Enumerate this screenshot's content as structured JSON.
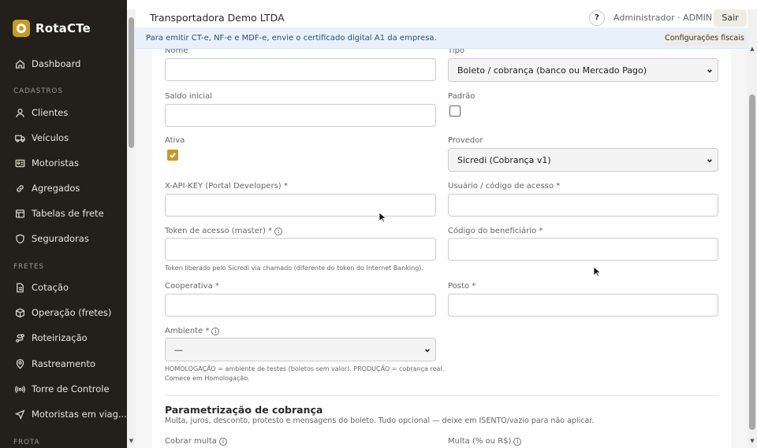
{
  "brand": {
    "name": "RotaCTe"
  },
  "sidebar": {
    "items": [
      {
        "label": "Dashboard",
        "icon": "home-icon"
      },
      {
        "label": "Clientes",
        "icon": "user-icon"
      },
      {
        "label": "Veículos",
        "icon": "truck-icon"
      },
      {
        "label": "Motoristas",
        "icon": "id-card-icon"
      },
      {
        "label": "Agregados",
        "icon": "link-icon"
      },
      {
        "label": "Tabelas de frete",
        "icon": "table-icon"
      },
      {
        "label": "Seguradoras",
        "icon": "shield-icon"
      },
      {
        "label": "Cotação",
        "icon": "document-icon"
      },
      {
        "label": "Operação (fretes)",
        "icon": "box-icon"
      },
      {
        "label": "Roteirização",
        "icon": "route-icon"
      },
      {
        "label": "Rastreamento",
        "icon": "location-pin-icon"
      },
      {
        "label": "Torre de Controle",
        "icon": "broadcast-icon"
      },
      {
        "label": "Motoristas em viag...",
        "icon": "navigation-icon"
      }
    ],
    "sections": {
      "cadastros": "CADASTROS",
      "fretes": "FRETES",
      "frota": "FROTA"
    }
  },
  "header": {
    "company": "Transportadora Demo LTDA",
    "help": "?",
    "user": "Administrador · ADMIN",
    "logout": "Sair"
  },
  "banner": {
    "text": "Para emitir CT-e, NF-e e MDF-e, envie o certificado digital A1 da empresa.",
    "button": "Configurações fiscais"
  },
  "form": {
    "nome_label": "Nome",
    "tipo_label": "Tipo",
    "tipo_value": "Boleto / cobrança (banco ou Mercado Pago)",
    "saldo_label": "Saldo inicial",
    "padrao_label": "Padrão",
    "ativa_label": "Ativa",
    "provedor_label": "Provedor",
    "provedor_value": "Sicredi (Cobrança v1)",
    "apikey_label": "X-API-KEY (Portal Developers) *",
    "usuario_label": "Usuário / código de acesso *",
    "token_label": "Token de acesso (master) *",
    "token_help": "Token liberado pelo Sicredi via chamado (diferente do token do Internet Banking).",
    "beneficiario_label": "Código do beneficiário *",
    "cooperativa_label": "Cooperativa *",
    "posto_label": "Posto *",
    "ambiente_label": "Ambiente *",
    "ambiente_value": "—",
    "ambiente_help_1": "HOMOLOGAÇÃO = ambiente de testes (boletos sem valor). PRODUÇÃO = cobrança real.",
    "ambiente_help_2": "Comece em Homologação.",
    "info_icon": "i"
  },
  "parametrizacao": {
    "title": "Parametrização de cobrança",
    "desc": "Multa, juros, desconto, protesto e mensagens do boleto. Tudo opcional — deixe em ISENTO/vazio para não aplicar.",
    "cobrar_multa_label": "Cobrar multa",
    "multa_label": "Multa (% ou R$)"
  },
  "state": {
    "ativa_checked": true,
    "padrao_checked": false
  },
  "colors": {
    "sidebar_bg": "#23201c",
    "accent": "#c79a24",
    "banner_bg": "#e8f1fb"
  }
}
